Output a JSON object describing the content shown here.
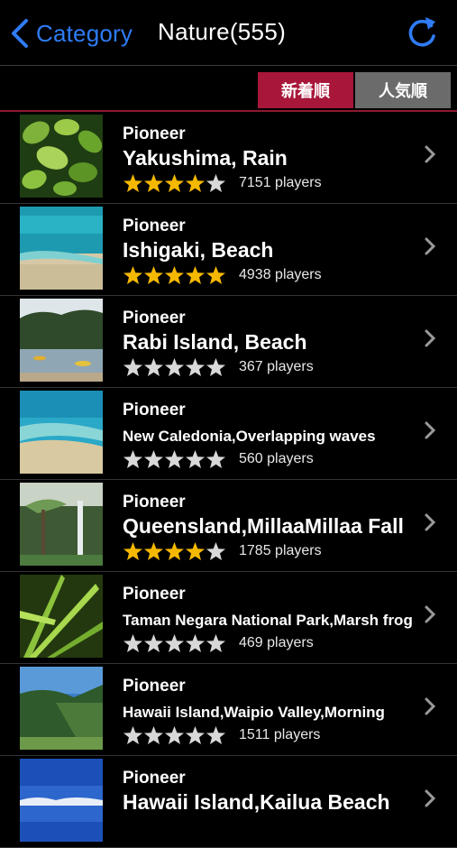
{
  "navbar": {
    "back_label": "Category",
    "title": "Nature(555)",
    "accent": "#2f7cf6"
  },
  "sort": {
    "newest_label": "新着順",
    "popular_label": "人気順",
    "active": "newest",
    "active_color": "#a8173a",
    "inactive_color": "#6b6b6b"
  },
  "items": [
    {
      "genre": "Pioneer",
      "name": "Yakushima, Rain",
      "rating": 4,
      "players": "7151 players",
      "thumb": "green-leaves"
    },
    {
      "genre": "Pioneer",
      "name": "Ishigaki, Beach",
      "rating": 5,
      "players": "4938 players",
      "thumb": "beach-water"
    },
    {
      "genre": "Pioneer",
      "name": "Rabi Island, Beach",
      "rating": 0,
      "players": "367 players",
      "thumb": "island-kayaks"
    },
    {
      "genre": "Pioneer",
      "name": "New Caledonia,Overlapping waves",
      "rating": 0,
      "players": "560 players",
      "thumb": "shallow-waves"
    },
    {
      "genre": "Pioneer",
      "name": "Queensland,MillaaMillaa Fall",
      "rating": 4,
      "players": "1785 players",
      "thumb": "waterfall-ferns"
    },
    {
      "genre": "Pioneer",
      "name": "Taman Negara National Park,Marsh frog",
      "rating": 0,
      "players": "469 players",
      "thumb": "palm-fronds"
    },
    {
      "genre": "Pioneer",
      "name": "Hawaii Island,Waipio Valley,Morning",
      "rating": 0,
      "players": "1511 players",
      "thumb": "valley-cliffs"
    },
    {
      "genre": "Pioneer",
      "name": "Hawaii Island,Kailua Beach",
      "rating": null,
      "players": "",
      "thumb": "blue-sky"
    }
  ],
  "colors": {
    "star_filled": "#f5b800",
    "star_empty": "#d8d8d8"
  }
}
